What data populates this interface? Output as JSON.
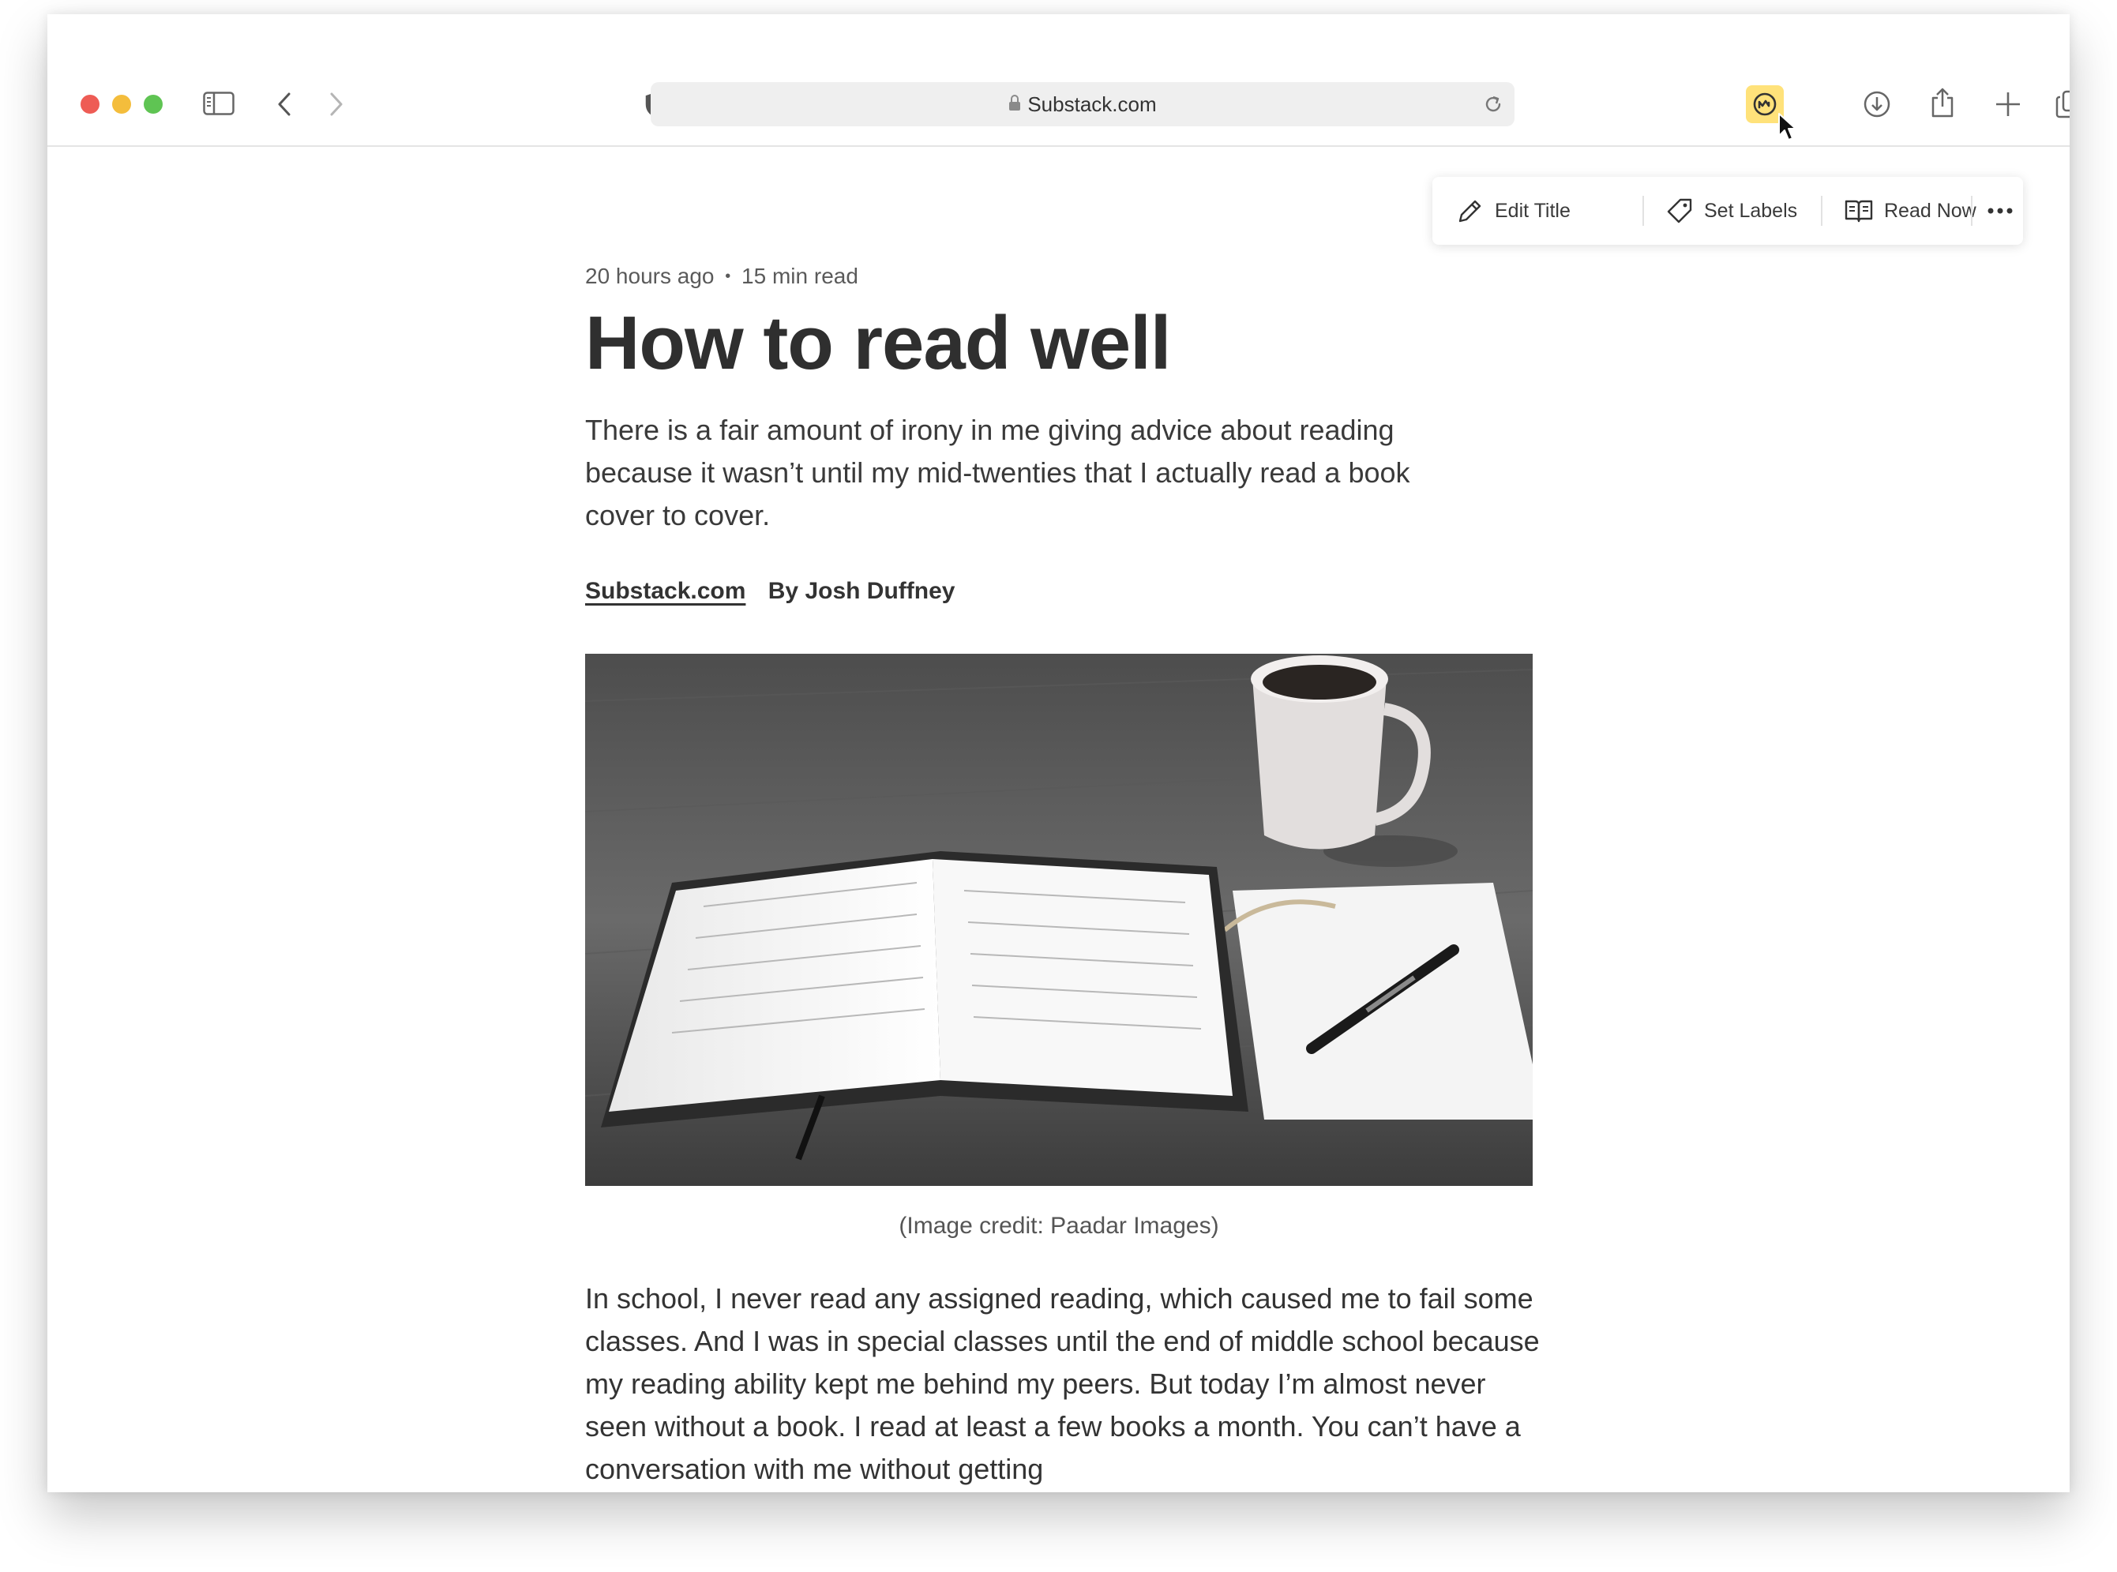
{
  "browser": {
    "url": "Substack.com"
  },
  "popover": {
    "edit_title": "Edit Title",
    "set_labels": "Set Labels",
    "read_now": "Read Now"
  },
  "article": {
    "time_ago": "20 hours ago",
    "separator": "•",
    "read_time": "15 min read",
    "title": "How to read well",
    "summary": "There is a fair amount of irony in me giving advice about reading because it wasn’t until my mid-twenties that I actually read a book cover to cover.",
    "source": "Substack.com",
    "author": "By Josh Duffney",
    "image_caption": "(Image credit: Paadar Images)",
    "body": "In school, I never read any assigned reading, which caused me to fail some classes. And I was in special classes until the end of middle school because my reading ability kept me behind my peers. But today I’m almost never seen without a book. I read at least a few books a month. You can’t have a conversation with me without getting"
  },
  "colors": {
    "extension_highlight": "#ffe27a",
    "traffic_red": "#ee5c55",
    "traffic_yellow": "#f4bd3c",
    "traffic_green": "#5fc453"
  }
}
